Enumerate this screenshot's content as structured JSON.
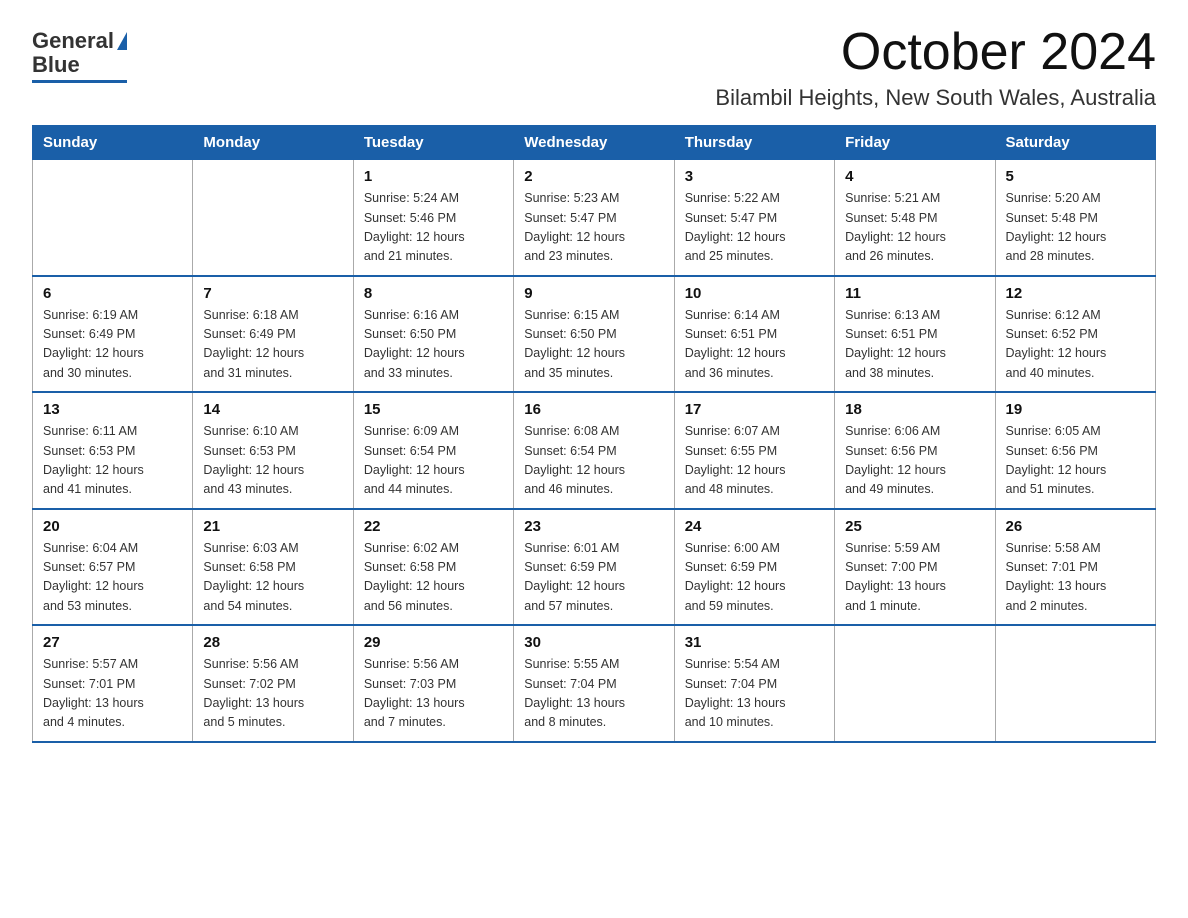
{
  "logo": {
    "general": "General",
    "blue": "Blue"
  },
  "header": {
    "month": "October 2024",
    "location": "Bilambil Heights, New South Wales, Australia"
  },
  "weekdays": [
    "Sunday",
    "Monday",
    "Tuesday",
    "Wednesday",
    "Thursday",
    "Friday",
    "Saturday"
  ],
  "weeks": [
    [
      {
        "day": "",
        "info": ""
      },
      {
        "day": "",
        "info": ""
      },
      {
        "day": "1",
        "info": "Sunrise: 5:24 AM\nSunset: 5:46 PM\nDaylight: 12 hours\nand 21 minutes."
      },
      {
        "day": "2",
        "info": "Sunrise: 5:23 AM\nSunset: 5:47 PM\nDaylight: 12 hours\nand 23 minutes."
      },
      {
        "day": "3",
        "info": "Sunrise: 5:22 AM\nSunset: 5:47 PM\nDaylight: 12 hours\nand 25 minutes."
      },
      {
        "day": "4",
        "info": "Sunrise: 5:21 AM\nSunset: 5:48 PM\nDaylight: 12 hours\nand 26 minutes."
      },
      {
        "day": "5",
        "info": "Sunrise: 5:20 AM\nSunset: 5:48 PM\nDaylight: 12 hours\nand 28 minutes."
      }
    ],
    [
      {
        "day": "6",
        "info": "Sunrise: 6:19 AM\nSunset: 6:49 PM\nDaylight: 12 hours\nand 30 minutes."
      },
      {
        "day": "7",
        "info": "Sunrise: 6:18 AM\nSunset: 6:49 PM\nDaylight: 12 hours\nand 31 minutes."
      },
      {
        "day": "8",
        "info": "Sunrise: 6:16 AM\nSunset: 6:50 PM\nDaylight: 12 hours\nand 33 minutes."
      },
      {
        "day": "9",
        "info": "Sunrise: 6:15 AM\nSunset: 6:50 PM\nDaylight: 12 hours\nand 35 minutes."
      },
      {
        "day": "10",
        "info": "Sunrise: 6:14 AM\nSunset: 6:51 PM\nDaylight: 12 hours\nand 36 minutes."
      },
      {
        "day": "11",
        "info": "Sunrise: 6:13 AM\nSunset: 6:51 PM\nDaylight: 12 hours\nand 38 minutes."
      },
      {
        "day": "12",
        "info": "Sunrise: 6:12 AM\nSunset: 6:52 PM\nDaylight: 12 hours\nand 40 minutes."
      }
    ],
    [
      {
        "day": "13",
        "info": "Sunrise: 6:11 AM\nSunset: 6:53 PM\nDaylight: 12 hours\nand 41 minutes."
      },
      {
        "day": "14",
        "info": "Sunrise: 6:10 AM\nSunset: 6:53 PM\nDaylight: 12 hours\nand 43 minutes."
      },
      {
        "day": "15",
        "info": "Sunrise: 6:09 AM\nSunset: 6:54 PM\nDaylight: 12 hours\nand 44 minutes."
      },
      {
        "day": "16",
        "info": "Sunrise: 6:08 AM\nSunset: 6:54 PM\nDaylight: 12 hours\nand 46 minutes."
      },
      {
        "day": "17",
        "info": "Sunrise: 6:07 AM\nSunset: 6:55 PM\nDaylight: 12 hours\nand 48 minutes."
      },
      {
        "day": "18",
        "info": "Sunrise: 6:06 AM\nSunset: 6:56 PM\nDaylight: 12 hours\nand 49 minutes."
      },
      {
        "day": "19",
        "info": "Sunrise: 6:05 AM\nSunset: 6:56 PM\nDaylight: 12 hours\nand 51 minutes."
      }
    ],
    [
      {
        "day": "20",
        "info": "Sunrise: 6:04 AM\nSunset: 6:57 PM\nDaylight: 12 hours\nand 53 minutes."
      },
      {
        "day": "21",
        "info": "Sunrise: 6:03 AM\nSunset: 6:58 PM\nDaylight: 12 hours\nand 54 minutes."
      },
      {
        "day": "22",
        "info": "Sunrise: 6:02 AM\nSunset: 6:58 PM\nDaylight: 12 hours\nand 56 minutes."
      },
      {
        "day": "23",
        "info": "Sunrise: 6:01 AM\nSunset: 6:59 PM\nDaylight: 12 hours\nand 57 minutes."
      },
      {
        "day": "24",
        "info": "Sunrise: 6:00 AM\nSunset: 6:59 PM\nDaylight: 12 hours\nand 59 minutes."
      },
      {
        "day": "25",
        "info": "Sunrise: 5:59 AM\nSunset: 7:00 PM\nDaylight: 13 hours\nand 1 minute."
      },
      {
        "day": "26",
        "info": "Sunrise: 5:58 AM\nSunset: 7:01 PM\nDaylight: 13 hours\nand 2 minutes."
      }
    ],
    [
      {
        "day": "27",
        "info": "Sunrise: 5:57 AM\nSunset: 7:01 PM\nDaylight: 13 hours\nand 4 minutes."
      },
      {
        "day": "28",
        "info": "Sunrise: 5:56 AM\nSunset: 7:02 PM\nDaylight: 13 hours\nand 5 minutes."
      },
      {
        "day": "29",
        "info": "Sunrise: 5:56 AM\nSunset: 7:03 PM\nDaylight: 13 hours\nand 7 minutes."
      },
      {
        "day": "30",
        "info": "Sunrise: 5:55 AM\nSunset: 7:04 PM\nDaylight: 13 hours\nand 8 minutes."
      },
      {
        "day": "31",
        "info": "Sunrise: 5:54 AM\nSunset: 7:04 PM\nDaylight: 13 hours\nand 10 minutes."
      },
      {
        "day": "",
        "info": ""
      },
      {
        "day": "",
        "info": ""
      }
    ]
  ]
}
